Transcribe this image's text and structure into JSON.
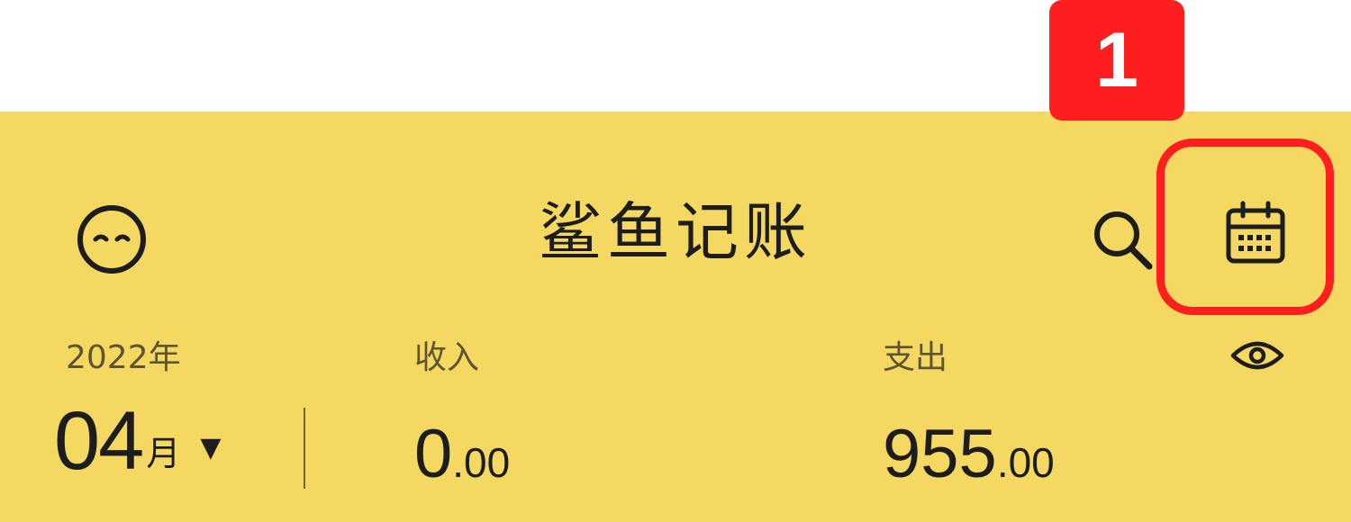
{
  "annotation": {
    "step_number": "1",
    "highlight_color": "#ff1f1f"
  },
  "header": {
    "background_color": "#f5d862",
    "title": "鲨鱼记账",
    "left_icon": "profile-face-icon",
    "right_icons": [
      "search-icon",
      "calendar-icon"
    ]
  },
  "summary": {
    "year_label": "2022年",
    "month_number": "04",
    "month_unit": "月",
    "month_dropdown_icon": "caret-down-icon",
    "income": {
      "label": "收入",
      "integer": "0",
      "decimal": ".00"
    },
    "expense": {
      "label": "支出",
      "integer": "955",
      "decimal": ".00"
    },
    "visibility_icon": "eye-icon"
  }
}
